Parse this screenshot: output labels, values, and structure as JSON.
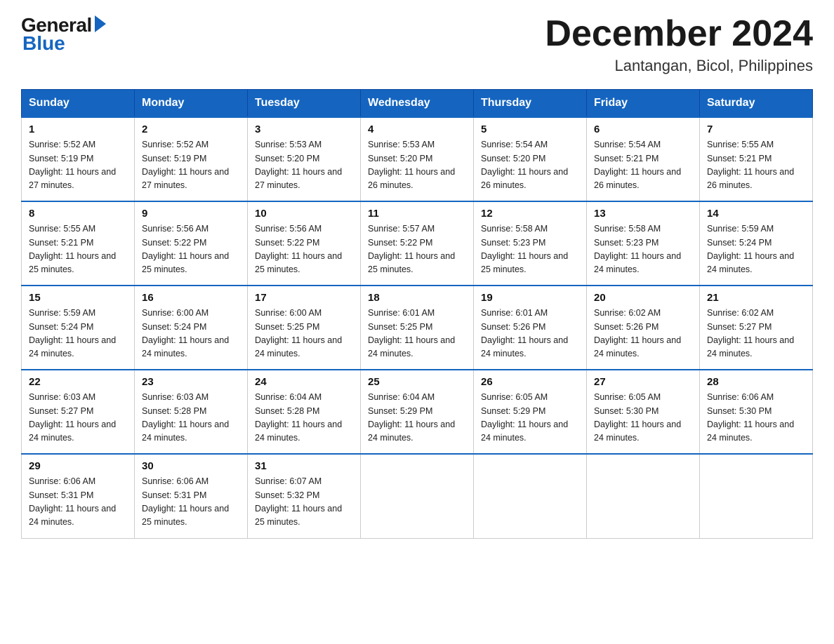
{
  "logo": {
    "general": "General",
    "blue": "Blue"
  },
  "title": "December 2024",
  "location": "Lantangan, Bicol, Philippines",
  "days_header": [
    "Sunday",
    "Monday",
    "Tuesday",
    "Wednesday",
    "Thursday",
    "Friday",
    "Saturday"
  ],
  "weeks": [
    [
      {
        "num": "1",
        "sunrise": "5:52 AM",
        "sunset": "5:19 PM",
        "daylight": "11 hours and 27 minutes."
      },
      {
        "num": "2",
        "sunrise": "5:52 AM",
        "sunset": "5:19 PM",
        "daylight": "11 hours and 27 minutes."
      },
      {
        "num": "3",
        "sunrise": "5:53 AM",
        "sunset": "5:20 PM",
        "daylight": "11 hours and 27 minutes."
      },
      {
        "num": "4",
        "sunrise": "5:53 AM",
        "sunset": "5:20 PM",
        "daylight": "11 hours and 26 minutes."
      },
      {
        "num": "5",
        "sunrise": "5:54 AM",
        "sunset": "5:20 PM",
        "daylight": "11 hours and 26 minutes."
      },
      {
        "num": "6",
        "sunrise": "5:54 AM",
        "sunset": "5:21 PM",
        "daylight": "11 hours and 26 minutes."
      },
      {
        "num": "7",
        "sunrise": "5:55 AM",
        "sunset": "5:21 PM",
        "daylight": "11 hours and 26 minutes."
      }
    ],
    [
      {
        "num": "8",
        "sunrise": "5:55 AM",
        "sunset": "5:21 PM",
        "daylight": "11 hours and 25 minutes."
      },
      {
        "num": "9",
        "sunrise": "5:56 AM",
        "sunset": "5:22 PM",
        "daylight": "11 hours and 25 minutes."
      },
      {
        "num": "10",
        "sunrise": "5:56 AM",
        "sunset": "5:22 PM",
        "daylight": "11 hours and 25 minutes."
      },
      {
        "num": "11",
        "sunrise": "5:57 AM",
        "sunset": "5:22 PM",
        "daylight": "11 hours and 25 minutes."
      },
      {
        "num": "12",
        "sunrise": "5:58 AM",
        "sunset": "5:23 PM",
        "daylight": "11 hours and 25 minutes."
      },
      {
        "num": "13",
        "sunrise": "5:58 AM",
        "sunset": "5:23 PM",
        "daylight": "11 hours and 24 minutes."
      },
      {
        "num": "14",
        "sunrise": "5:59 AM",
        "sunset": "5:24 PM",
        "daylight": "11 hours and 24 minutes."
      }
    ],
    [
      {
        "num": "15",
        "sunrise": "5:59 AM",
        "sunset": "5:24 PM",
        "daylight": "11 hours and 24 minutes."
      },
      {
        "num": "16",
        "sunrise": "6:00 AM",
        "sunset": "5:24 PM",
        "daylight": "11 hours and 24 minutes."
      },
      {
        "num": "17",
        "sunrise": "6:00 AM",
        "sunset": "5:25 PM",
        "daylight": "11 hours and 24 minutes."
      },
      {
        "num": "18",
        "sunrise": "6:01 AM",
        "sunset": "5:25 PM",
        "daylight": "11 hours and 24 minutes."
      },
      {
        "num": "19",
        "sunrise": "6:01 AM",
        "sunset": "5:26 PM",
        "daylight": "11 hours and 24 minutes."
      },
      {
        "num": "20",
        "sunrise": "6:02 AM",
        "sunset": "5:26 PM",
        "daylight": "11 hours and 24 minutes."
      },
      {
        "num": "21",
        "sunrise": "6:02 AM",
        "sunset": "5:27 PM",
        "daylight": "11 hours and 24 minutes."
      }
    ],
    [
      {
        "num": "22",
        "sunrise": "6:03 AM",
        "sunset": "5:27 PM",
        "daylight": "11 hours and 24 minutes."
      },
      {
        "num": "23",
        "sunrise": "6:03 AM",
        "sunset": "5:28 PM",
        "daylight": "11 hours and 24 minutes."
      },
      {
        "num": "24",
        "sunrise": "6:04 AM",
        "sunset": "5:28 PM",
        "daylight": "11 hours and 24 minutes."
      },
      {
        "num": "25",
        "sunrise": "6:04 AM",
        "sunset": "5:29 PM",
        "daylight": "11 hours and 24 minutes."
      },
      {
        "num": "26",
        "sunrise": "6:05 AM",
        "sunset": "5:29 PM",
        "daylight": "11 hours and 24 minutes."
      },
      {
        "num": "27",
        "sunrise": "6:05 AM",
        "sunset": "5:30 PM",
        "daylight": "11 hours and 24 minutes."
      },
      {
        "num": "28",
        "sunrise": "6:06 AM",
        "sunset": "5:30 PM",
        "daylight": "11 hours and 24 minutes."
      }
    ],
    [
      {
        "num": "29",
        "sunrise": "6:06 AM",
        "sunset": "5:31 PM",
        "daylight": "11 hours and 24 minutes."
      },
      {
        "num": "30",
        "sunrise": "6:06 AM",
        "sunset": "5:31 PM",
        "daylight": "11 hours and 25 minutes."
      },
      {
        "num": "31",
        "sunrise": "6:07 AM",
        "sunset": "5:32 PM",
        "daylight": "11 hours and 25 minutes."
      },
      null,
      null,
      null,
      null
    ]
  ]
}
